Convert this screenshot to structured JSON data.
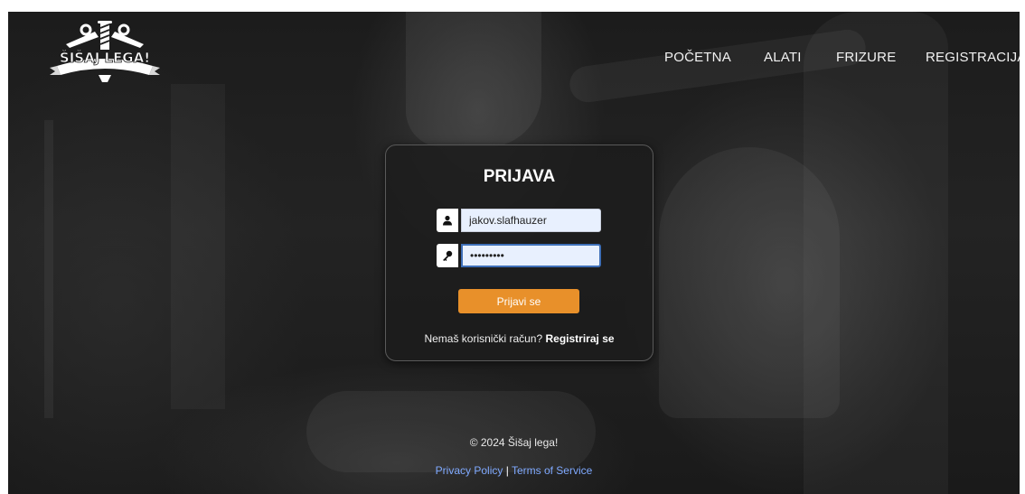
{
  "logo": {
    "text": "ŠIŠAJ LEGA!"
  },
  "nav": {
    "items": [
      {
        "label": "POČETNA"
      },
      {
        "label": "ALATI"
      },
      {
        "label": "FRIZURE"
      },
      {
        "label": "REGISTRACIJA"
      }
    ]
  },
  "login": {
    "title": "PRIJAVA",
    "username": {
      "value": "jakov.slafhauzer",
      "icon": "user-icon"
    },
    "password": {
      "value": "•••••••••",
      "icon": "key-icon"
    },
    "submit_label": "Prijavi se",
    "register_prompt": "Nemaš korisnički račun?",
    "register_link": "Registriraj se"
  },
  "footer": {
    "copyright": "© 2024 Šišaj lega!",
    "privacy": "Privacy Policy",
    "separator": "|",
    "terms": "Terms of Service"
  },
  "colors": {
    "accent": "#e8902a",
    "link": "#7fa9ff",
    "background": "#1f1f1f"
  }
}
